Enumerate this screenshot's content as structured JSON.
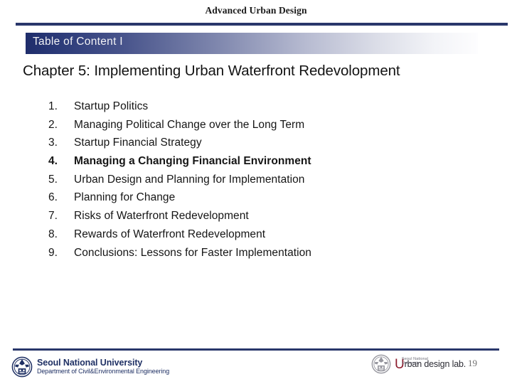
{
  "header": {
    "course_title": "Advanced Urban Design"
  },
  "banner": {
    "label": "Table of Content I"
  },
  "chapter": {
    "title": "Chapter 5: Implementing Urban Waterfront Redevolopment"
  },
  "toc": {
    "items": [
      {
        "num": "1.",
        "label": "Startup Politics",
        "bold": false
      },
      {
        "num": "2.",
        "label": "Managing Political Change over the Long Term",
        "bold": false
      },
      {
        "num": "3.",
        "label": "Startup Financial Strategy",
        "bold": false
      },
      {
        "num": "4.",
        "label": "Managing a Changing Financial Environment",
        "bold": true
      },
      {
        "num": "5.",
        "label": "Urban Design and Planning for Implementation",
        "bold": false
      },
      {
        "num": "6.",
        "label": "Planning for Change",
        "bold": false
      },
      {
        "num": "7.",
        "label": "Risks of Waterfront Redevelopment",
        "bold": false
      },
      {
        "num": "8.",
        "label": "Rewards of Waterfront Redevelopment",
        "bold": false
      },
      {
        "num": "9.",
        "label": "Conclusions: Lessons for Faster Implementation",
        "bold": false
      }
    ]
  },
  "footer": {
    "university_name": "Seoul National University",
    "department_name": "Department of Civil&Environmental Engineering",
    "lab_sub_line1": "Seoul National",
    "lab_sub_line2": "University",
    "lab_initial": "U",
    "lab_name": "rban design lab.",
    "page_number": "19"
  },
  "colors": {
    "navy_rule": "#29376b",
    "banner_start": "#1f2d6b",
    "banner_end": "#fdfdfe",
    "brand_navy": "#1f3064",
    "lab_maroon": "#8b1a2b",
    "page_number_gray": "#6f6f6f"
  }
}
